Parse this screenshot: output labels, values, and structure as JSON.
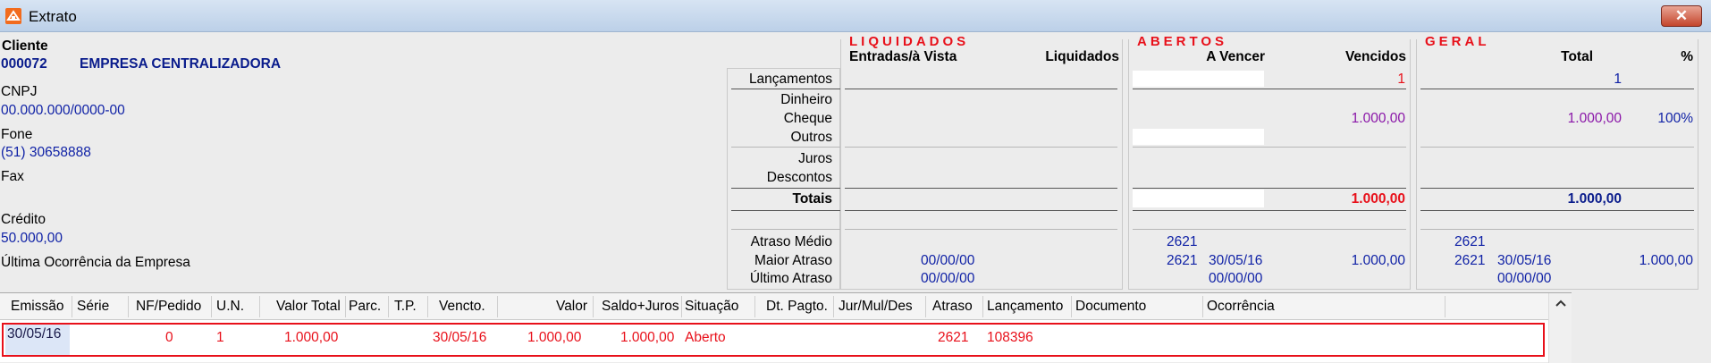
{
  "window": {
    "title": "Extrato",
    "close_label": "✕"
  },
  "client": {
    "cliente_label": "Cliente",
    "code": "000072",
    "name": "EMPRESA CENTRALIZADORA",
    "cnpj_label": "CNPJ",
    "cnpj": "00.000.000/0000-00",
    "fone_label": "Fone",
    "fone": "(51) 30658888",
    "fax_label": "Fax",
    "credito_label": "Crédito",
    "credito": "50.000,00",
    "ultima_label": "Última Ocorrência da Empresa"
  },
  "row_labels": {
    "lancamentos": "Lançamentos",
    "dinheiro": "Dinheiro",
    "cheque": "Cheque",
    "outros": "Outros",
    "juros": "Juros",
    "descontos": "Descontos",
    "totais": "Totais",
    "atraso_medio": "Atraso Médio",
    "maior_atraso": "Maior Atraso",
    "ultimo_atraso": "Último Atraso"
  },
  "liquidados": {
    "title": "LIQUIDADOS",
    "col1": "Entradas/à Vista",
    "col2": "Liquidados",
    "maior_atraso_date": "00/00/00",
    "ultimo_atraso_date": "00/00/00"
  },
  "abertos": {
    "title": "ABERTOS",
    "col1": "A Vencer",
    "col2": "Vencidos",
    "lancamentos": "1",
    "cheque": "1.000,00",
    "totais": "1.000,00",
    "atraso_medio": "2621",
    "maior_atraso_days": "2621",
    "maior_atraso_date": "30/05/16",
    "maior_atraso_value": "1.000,00",
    "ultimo_atraso_date": "00/00/00"
  },
  "geral": {
    "title": "GERAL",
    "col1": "Total",
    "col2": "%",
    "lancamentos": "1",
    "cheque": "1.000,00",
    "cheque_pct": "100%",
    "totais": "1.000,00",
    "atraso_medio": "2621",
    "maior_atraso_days": "2621",
    "maior_atraso_date": "30/05/16",
    "maior_atraso_value": "1.000,00",
    "ultimo_atraso_date": "00/00/00"
  },
  "table": {
    "headers": [
      "Emissão",
      "Série",
      "NF/Pedido",
      "U.N.",
      "Valor Total",
      "Parc.",
      "T.P.",
      "Vencto.",
      "Valor",
      "Saldo+Juros",
      "Situação",
      "Dt. Pagto.",
      "Jur/Mul/Des",
      "Atraso",
      "Lançamento",
      "Documento",
      "Ocorrência"
    ],
    "rows": [
      {
        "emissao": "30/05/16",
        "serie": "",
        "nf_pedido": "0",
        "un": "1",
        "valor_total": "1.000,00",
        "parc": "",
        "tp": "",
        "vencto": "30/05/16",
        "valor": "1.000,00",
        "saldo_juros": "1.000,00",
        "situacao": "Aberto",
        "dt_pagto": "",
        "jur_mul_des": "",
        "atraso": "2621",
        "lancamento": "108396",
        "documento": "",
        "ocorrencia": ""
      }
    ]
  }
}
